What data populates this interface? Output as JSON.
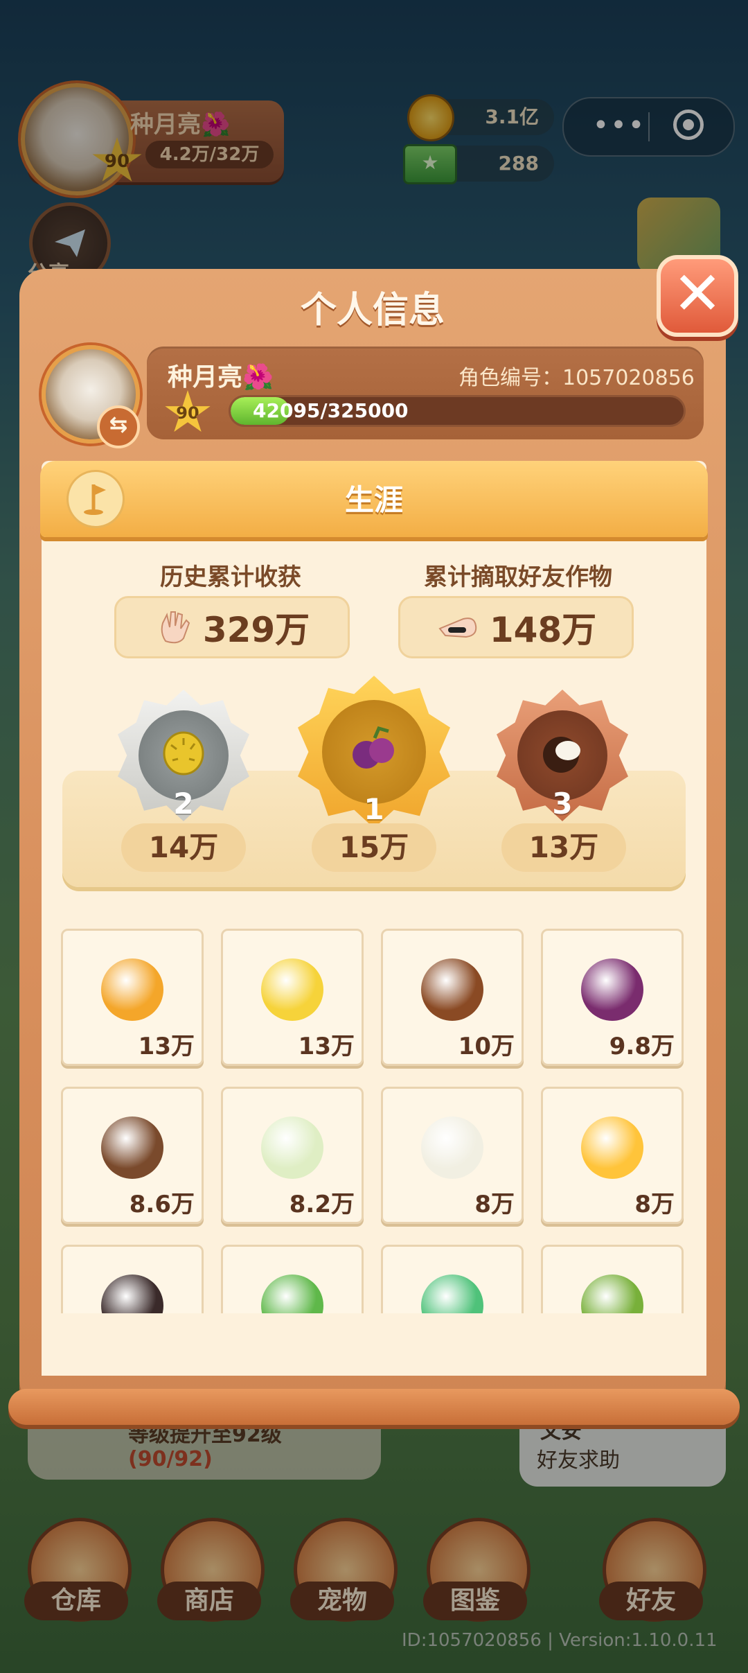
{
  "hud": {
    "player_name": "种月亮🌺",
    "level": "90",
    "exp_short": "4.2万/32万",
    "coins": "3.1亿",
    "cash": "288",
    "share_label": "分享"
  },
  "background": {
    "quest_text": "等级提升至92级",
    "quest_progress": "(90/92)",
    "friend_name": "文安",
    "friend_request": "好友求助",
    "nav": [
      "仓库",
      "商店",
      "宠物",
      "图鉴",
      "好友"
    ],
    "version": "ID:1057020856 | Version:1.10.0.11"
  },
  "modal": {
    "title": "个人信息",
    "close_label": "✕",
    "player_name": "种月亮🌺",
    "role_id": "角色编号：1057020856",
    "level": "90",
    "exp_text": "42095/325000",
    "exp_fraction": 0.1295,
    "section_title": "生涯",
    "stats": [
      {
        "label": "历史累计收获",
        "value": "329万",
        "icon": "hand-icon"
      },
      {
        "label": "累计摘取好友作物",
        "value": "148万",
        "icon": "thief-hand-icon"
      }
    ],
    "podium": [
      {
        "rank": "2",
        "value": "14万",
        "item": "durian",
        "medal": "silver"
      },
      {
        "rank": "1",
        "value": "15万",
        "item": "plum",
        "medal": "gold"
      },
      {
        "rank": "3",
        "value": "13万",
        "item": "coconut",
        "medal": "bronze"
      }
    ],
    "crops": [
      {
        "name": "orange",
        "value": "13万",
        "color": "#f4a62a"
      },
      {
        "name": "yellow-flower",
        "value": "13万",
        "color": "#f6d33a"
      },
      {
        "name": "chestnut",
        "value": "10万",
        "color": "#8a4a24"
      },
      {
        "name": "blackberry",
        "value": "9.8万",
        "color": "#7a2c6e"
      },
      {
        "name": "mushroom",
        "value": "8.6万",
        "color": "#7a4a2c"
      },
      {
        "name": "white-melon",
        "value": "8.2万",
        "color": "#dfeec4"
      },
      {
        "name": "radish",
        "value": "8万",
        "color": "#f1efe2"
      },
      {
        "name": "golden-heart",
        "value": "8万",
        "color": "#ffc43a"
      },
      {
        "name": "sugarcane",
        "value": "",
        "color": "#3a2a2a"
      },
      {
        "name": "leafy-green",
        "value": "",
        "color": "#5fb84a"
      },
      {
        "name": "clover",
        "value": "",
        "color": "#4fc27a"
      },
      {
        "name": "sapling",
        "value": "",
        "color": "#78b03a"
      }
    ]
  }
}
